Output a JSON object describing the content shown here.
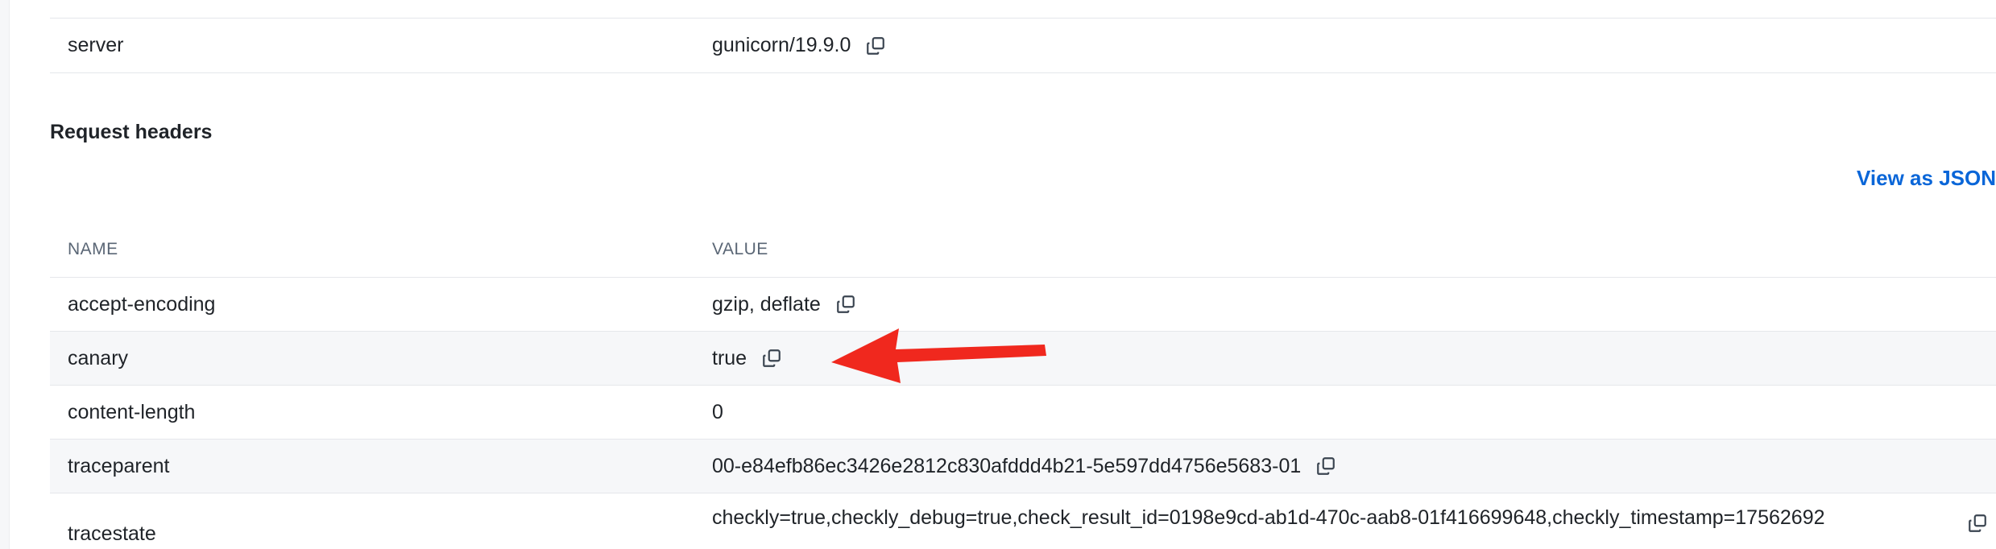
{
  "response_headers": {
    "top_fragment": "...  ...g...",
    "server": {
      "name": "server",
      "value": "gunicorn/19.9.0"
    }
  },
  "request_headers": {
    "title": "Request headers",
    "view_json_label": "View as JSON",
    "columns": {
      "name": "NAME",
      "value": "VALUE"
    },
    "rows": [
      {
        "name": "accept-encoding",
        "value": "gzip, deflate"
      },
      {
        "name": "canary",
        "value": "true"
      },
      {
        "name": "content-length",
        "value": "0"
      },
      {
        "name": "traceparent",
        "value": "00-e84efb86ec3426e2812c830afddd4b21-5e597dd4756e5683-01"
      },
      {
        "name": "tracestate",
        "value": "checkly=true,checkly_debug=true,check_result_id=0198e9cd-ab1d-470c-aab8-01f416699648,checkly_timestamp=17562692"
      }
    ]
  },
  "annotation": {
    "arrow_color": "#f0281e"
  },
  "colors": {
    "link": "#0a66d8",
    "row_alt": "#f6f7f9"
  }
}
